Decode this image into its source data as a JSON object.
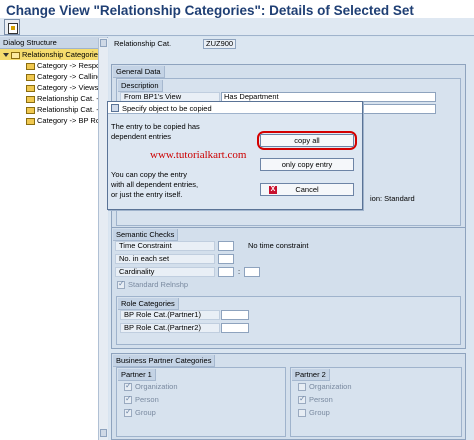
{
  "window": {
    "title": "Change View \"Relationship Categories\": Details of Selected Set"
  },
  "toolbar": {
    "icons": [
      "expand-icon"
    ]
  },
  "dialog_structure": {
    "header": "Dialog Structure",
    "root": "Relationship Categories",
    "children": [
      "Category -> Respons",
      "Category -> Calling A",
      "Category -> Views",
      "Relationship Cat. ->",
      "Relationship Cat. ->",
      "Category -> BP Role"
    ]
  },
  "header_field": {
    "label": "Relationship Cat.",
    "value": "ZUZ900"
  },
  "general_data": {
    "title": "General Data",
    "description": {
      "title": "Description",
      "from_label": "From BP1's View",
      "from_value": "Has Department",
      "standard_tail": "ion: Standard"
    }
  },
  "dialog": {
    "title": "Specify object to be copied",
    "text1_line1": "The entry to be copied has",
    "text1_line2": "dependent entries",
    "text2_line1": "You can copy the entry",
    "text2_line2": "with all dependent entries,",
    "text2_line3": "or just the entry itself.",
    "copy_all": "copy all",
    "only_copy_entry": "only copy entry",
    "cancel": "Cancel",
    "cancel_icon": "X"
  },
  "watermark": "www.tutorialkart.com",
  "semantic_checks": {
    "title": "Semantic Checks",
    "time_constraint_label": "Time Constraint",
    "time_constraint_value": "No time constraint",
    "no_in_set_label": "No. in each set",
    "cardinality_label": "Cardinality",
    "cardinality_sep": ":",
    "standard_relnship": "Standard Relnshp"
  },
  "role_categories": {
    "title": "Role Categories",
    "partner1_label": "BP Role Cat.(Partner1)",
    "partner2_label": "BP Role Cat.(Partner2)"
  },
  "bp_categories": {
    "title": "Business Partner Categories",
    "partner1": {
      "title": "Partner 1",
      "organization": "Organization",
      "person": "Person",
      "group": "Group"
    },
    "partner2": {
      "title": "Partner 2",
      "organization": "Organization",
      "person": "Person",
      "group": "Group"
    }
  },
  "colors": {
    "title": "#1f3f74",
    "highlight": "#d40000",
    "watermark": "#cc0000",
    "selection": "#f5dc6e"
  }
}
